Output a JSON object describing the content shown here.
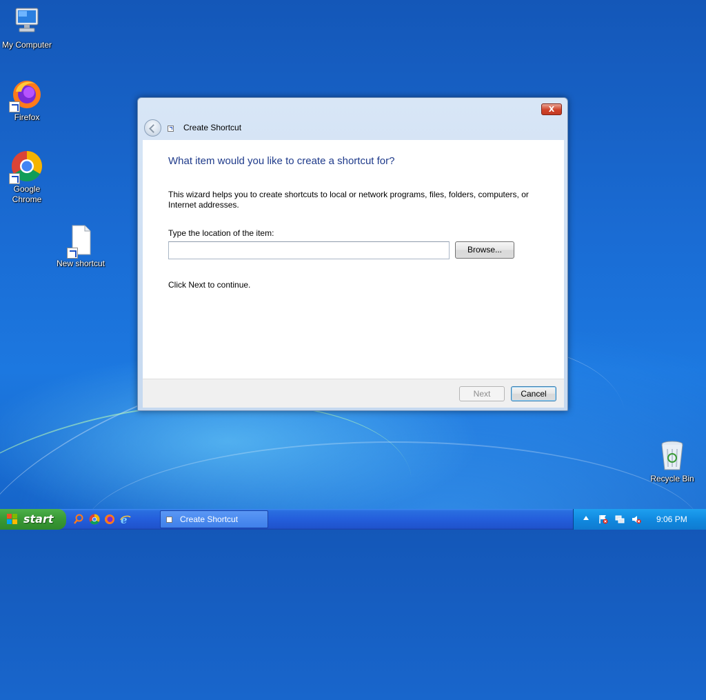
{
  "desktop": {
    "icons": [
      {
        "label": "My Computer",
        "icon": "computer-icon"
      },
      {
        "label": "Firefox",
        "icon": "firefox-icon"
      },
      {
        "label": "Google Chrome",
        "icon": "chrome-icon"
      },
      {
        "label": "New shortcut",
        "icon": "shortcut-file-icon"
      },
      {
        "label": "Recycle Bin",
        "icon": "recycle-bin-icon"
      }
    ]
  },
  "dialog": {
    "title": "Create Shortcut",
    "close_symbol": "X",
    "heading": "What item would you like to create a shortcut for?",
    "description": "This wizard helps you to create shortcuts to local or network programs, files, folders, computers, or Internet addresses.",
    "location_label": "Type the location of the item:",
    "location_value": "",
    "browse_label": "Browse...",
    "continue_text": "Click Next to continue.",
    "next_label": "Next",
    "cancel_label": "Cancel"
  },
  "taskbar": {
    "start_label": "start",
    "quick_launch": [
      "search-icon",
      "chrome-icon",
      "firefox-icon",
      "internet-explorer-icon"
    ],
    "task_button_label": "Create Shortcut",
    "tray_icons": [
      "show-hidden-icons",
      "action-center-icon",
      "network-icon",
      "volume-muted-icon"
    ],
    "clock": "9:06 PM"
  },
  "colors": {
    "heading": "#1e3a8a",
    "taskbar": "#245edb",
    "start_button": "#3a9a36",
    "close_button": "#c23a22"
  }
}
